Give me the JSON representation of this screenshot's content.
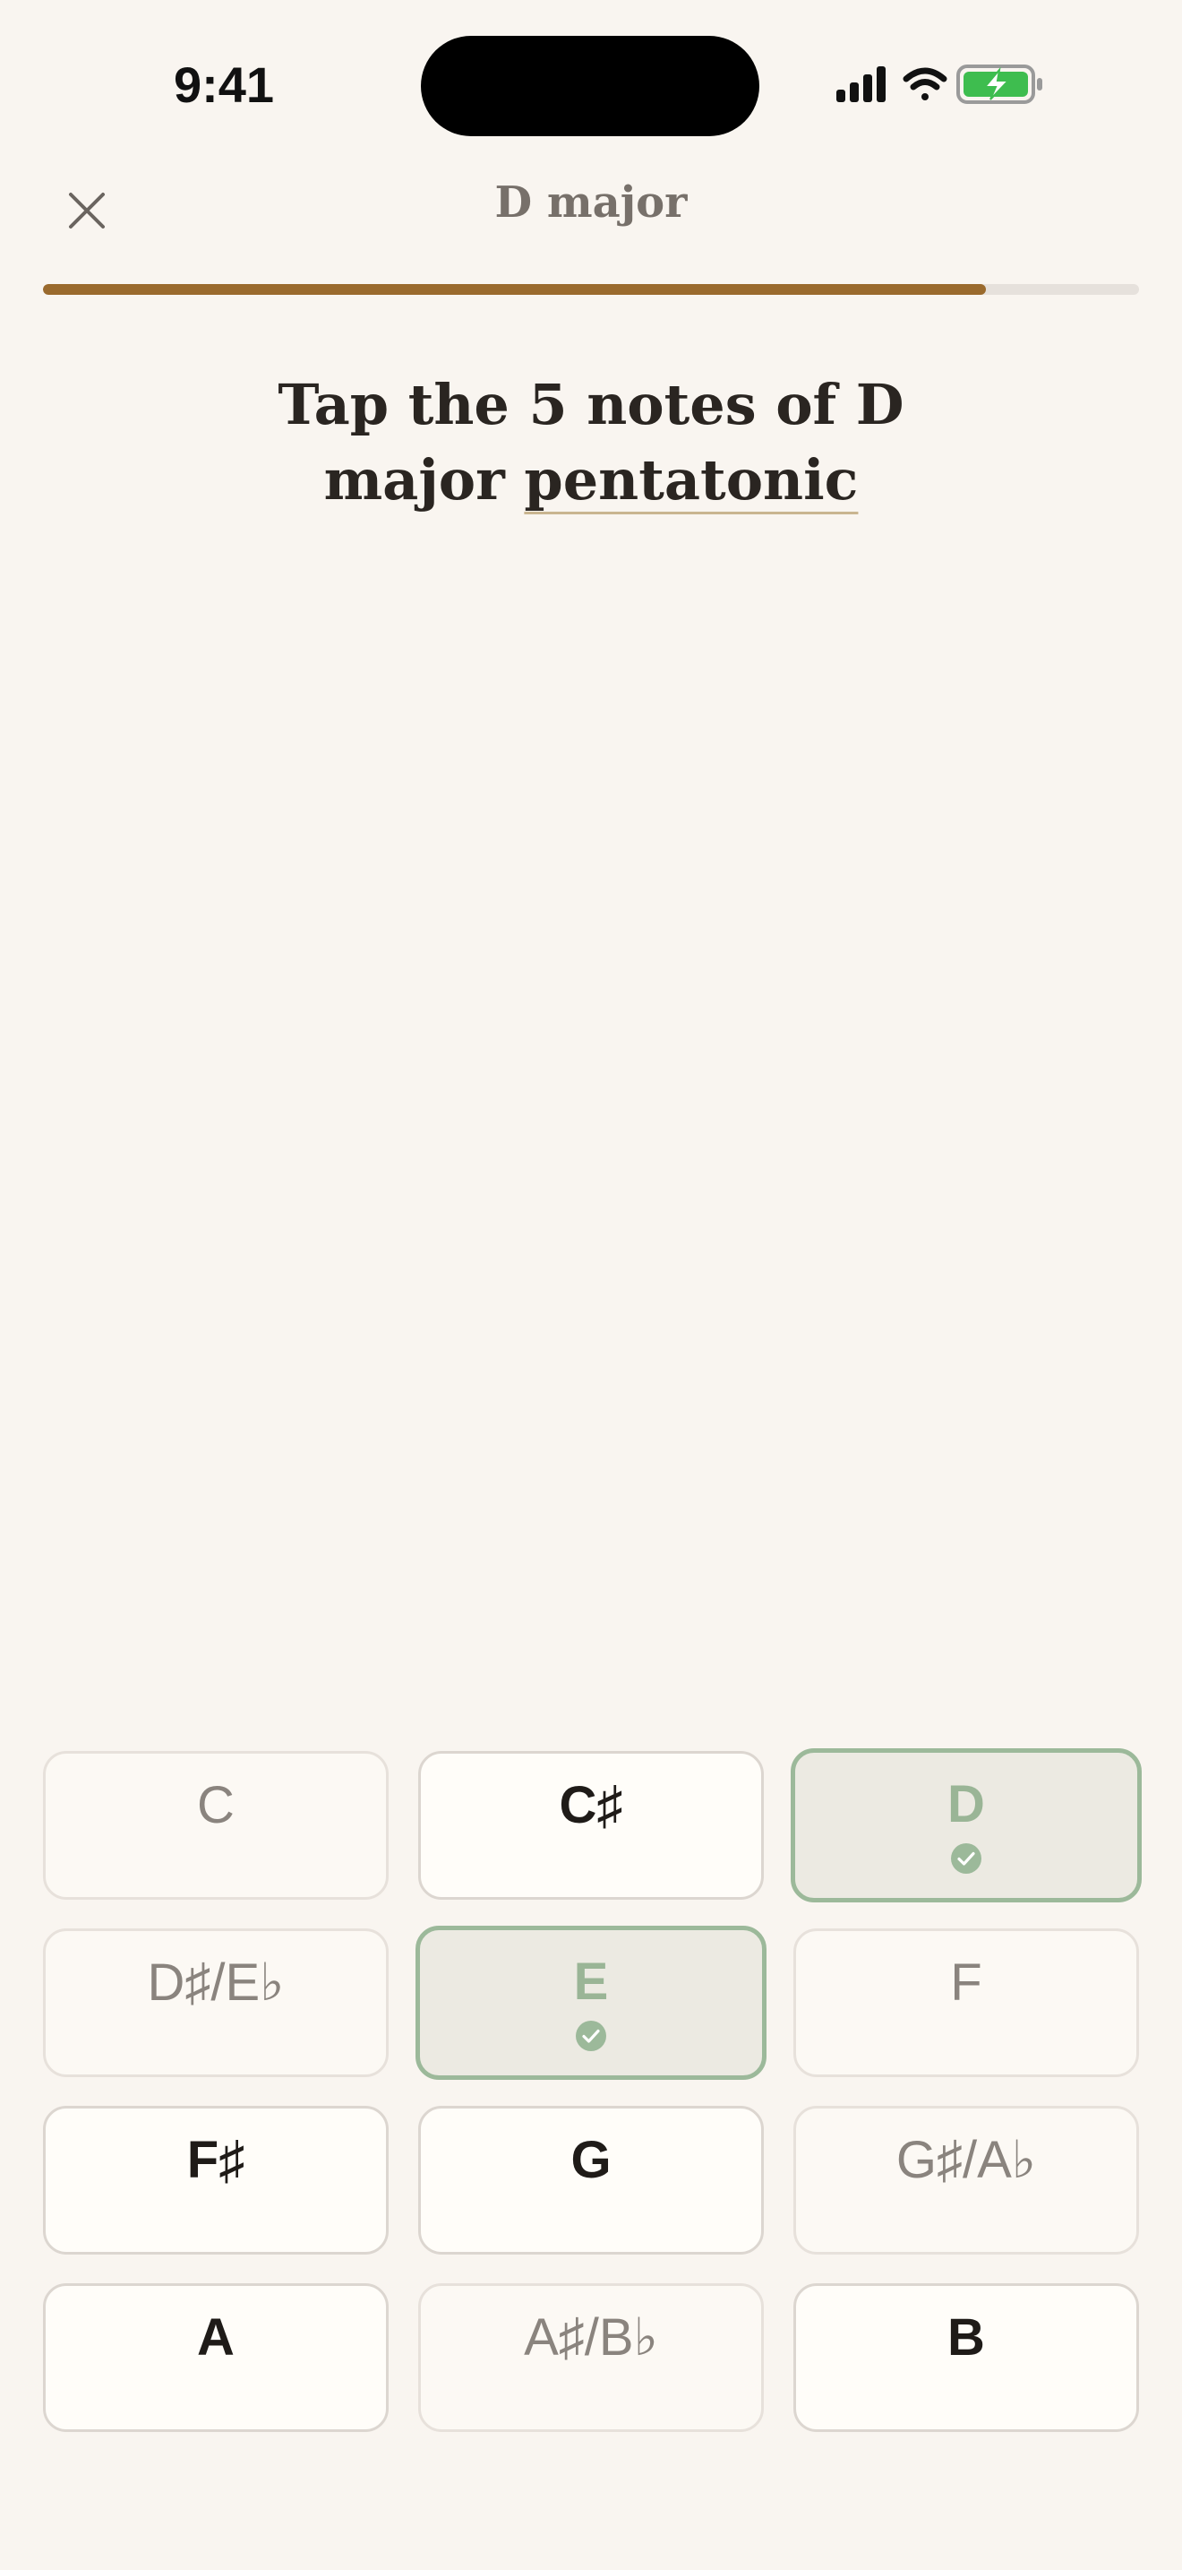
{
  "status_bar": {
    "time": "9:41"
  },
  "header": {
    "title": "D major",
    "progress": 0.86
  },
  "prompt": {
    "text_before": "Tap the 5 notes of D major ",
    "term": "pentatonic"
  },
  "notes": [
    {
      "label": "C",
      "state": "dim"
    },
    {
      "label": "C♯",
      "state": "active"
    },
    {
      "label": "D",
      "state": "correct"
    },
    {
      "label": "D♯/E♭",
      "state": "dim"
    },
    {
      "label": "E",
      "state": "correct"
    },
    {
      "label": "F",
      "state": "dim"
    },
    {
      "label": "F♯",
      "state": "active"
    },
    {
      "label": "G",
      "state": "active"
    },
    {
      "label": "G♯/A♭",
      "state": "dim"
    },
    {
      "label": "A",
      "state": "active"
    },
    {
      "label": "A♯/B♭",
      "state": "dim"
    },
    {
      "label": "B",
      "state": "active"
    }
  ],
  "colors": {
    "accent": "#9a6a2d",
    "correct": "#9cb99a",
    "background": "#f9f5f0"
  }
}
